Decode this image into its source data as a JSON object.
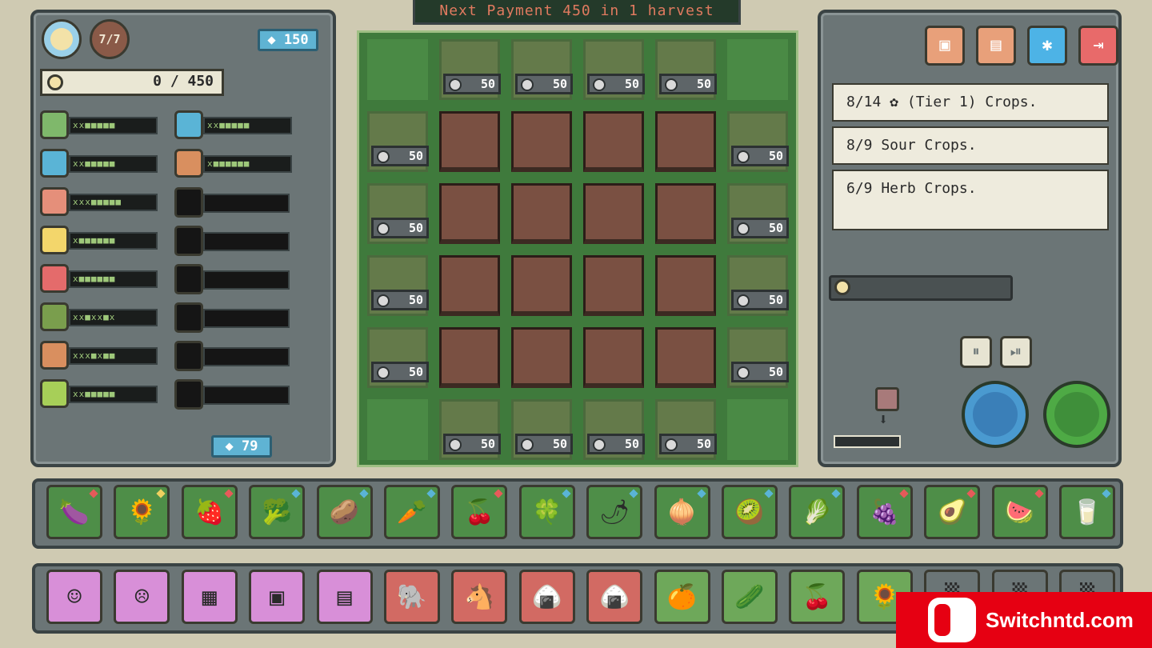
{
  "banner": {
    "text": "Next Payment 450 in 1 harvest"
  },
  "left_panel": {
    "day_counter": "7/7",
    "coins": "150",
    "money_progress": "0 / 450",
    "seed_coins": "79",
    "money_progress_fraction": 0.0
  },
  "stats": [
    {
      "icon": "leaf-icon",
      "color": "#7fb86b",
      "pips": "xx■■■■■"
    },
    {
      "icon": "snowflake-icon",
      "color": "#5ab4d6",
      "pips": "xx■■■■■"
    },
    {
      "icon": "berry-icon",
      "color": "#e58f7a",
      "pips": "xxx■■■■■"
    },
    {
      "icon": "smile-icon",
      "color": "#f3d66b",
      "pips": "x■■■■■■"
    },
    {
      "icon": "angry-face-icon",
      "color": "#e46b6b",
      "pips": "x■■■■■■"
    },
    {
      "icon": "seeds-icon",
      "color": "#7a9e4d",
      "pips": "xx■xx■x"
    },
    {
      "icon": "moon-icon",
      "color": "#d98f5f",
      "pips": "xxx■x■■"
    },
    {
      "icon": "flower-icon",
      "color": "#a7cf58",
      "pips": "xx■■■■■"
    },
    {
      "icon": "water-drop-icon",
      "color": "#5ab4d6",
      "pips": "xx■■■■■"
    },
    {
      "icon": "brush-icon",
      "color": "#d98f5f",
      "pips": "x■■■■■■"
    }
  ],
  "farm": {
    "plot_price": "50"
  },
  "menu": {
    "buttons": [
      {
        "icon": "save-icon",
        "color": "#e8a07a",
        "glyph": "▣"
      },
      {
        "icon": "notes-icon",
        "color": "#e8a07a",
        "glyph": "▤"
      },
      {
        "icon": "settings-icon",
        "color": "#4db3e6",
        "glyph": "✱"
      },
      {
        "icon": "exit-icon",
        "color": "#e86a6a",
        "glyph": "⇥"
      }
    ]
  },
  "quests": [
    {
      "text": "8/14 ✿ (Tier 1) Crops."
    },
    {
      "text": "8/9 Sour Crops."
    },
    {
      "text": "6/9 Herb Crops."
    }
  ],
  "controls": {
    "pause_glyph": "⏸",
    "play_glyph": "⏯"
  },
  "crop_cards": [
    {
      "icon": "eggplant-icon",
      "glyph": "🍆",
      "dot": "#e65a5a"
    },
    {
      "icon": "sunflower-icon",
      "glyph": "🌻",
      "dot": "#f0d060"
    },
    {
      "icon": "strawberry-icon",
      "glyph": "🍓",
      "dot": "#e65a5a"
    },
    {
      "icon": "broccoli-icon",
      "glyph": "🥦",
      "dot": "#5ab4d6"
    },
    {
      "icon": "potato-icon",
      "glyph": "🥔",
      "dot": "#5ab4d6"
    },
    {
      "icon": "carrot-icon",
      "glyph": "🥕",
      "dot": "#5ab4d6"
    },
    {
      "icon": "cherries-icon",
      "glyph": "🍒",
      "dot": "#e65a5a"
    },
    {
      "icon": "clover-icon",
      "glyph": "🍀",
      "dot": "#5ab4d6"
    },
    {
      "icon": "chili-icon",
      "glyph": "🌶",
      "dot": "#5ab4d6"
    },
    {
      "icon": "turnip-icon",
      "glyph": "🧅",
      "dot": "#5ab4d6"
    },
    {
      "icon": "kiwi-icon",
      "glyph": "🥝",
      "dot": "#5ab4d6"
    },
    {
      "icon": "celery-icon",
      "glyph": "🥬",
      "dot": "#5ab4d6"
    },
    {
      "icon": "grapes-icon",
      "glyph": "🍇",
      "dot": "#e65a5a"
    },
    {
      "icon": "avocado-icon",
      "glyph": "🥑",
      "dot": "#e65a5a"
    },
    {
      "icon": "watermelon-icon",
      "glyph": "🍉",
      "dot": "#e65a5a"
    },
    {
      "icon": "milk-icon",
      "glyph": "🥛",
      "dot": "#5ab4d6"
    }
  ],
  "item_cards": [
    {
      "icon": "happy-note-icon",
      "glyph": "☺",
      "bg": "#d88fd8"
    },
    {
      "icon": "sad-note-icon",
      "glyph": "☹",
      "bg": "#d88fd8"
    },
    {
      "icon": "grid-note-icon",
      "glyph": "▦",
      "bg": "#d88fd8"
    },
    {
      "icon": "berry-note-icon",
      "glyph": "▣",
      "bg": "#d88fd8"
    },
    {
      "icon": "color-note-icon",
      "glyph": "▤",
      "bg": "#d88fd8"
    },
    {
      "icon": "elephant-icon",
      "glyph": "🐘",
      "bg": "#d26a63"
    },
    {
      "icon": "horse-icon",
      "glyph": "🐴",
      "bg": "#d26a63"
    },
    {
      "icon": "onigiri-icon",
      "glyph": "🍙",
      "bg": "#d26a63"
    },
    {
      "icon": "onigiri-alt-icon",
      "glyph": "🍙",
      "bg": "#d26a63"
    },
    {
      "icon": "orange-icon",
      "glyph": "🍊",
      "bg": "#6ea85a"
    },
    {
      "icon": "pickle-icon",
      "glyph": "🥒",
      "bg": "#6ea85a"
    },
    {
      "icon": "cherries-icon",
      "glyph": "🍒",
      "bg": "#6ea85a"
    },
    {
      "icon": "sunflower-icon",
      "glyph": "🌻",
      "bg": "#6ea85a"
    },
    {
      "icon": "locked-slot-icon",
      "glyph": "▒",
      "bg": "#6b7576"
    },
    {
      "icon": "locked-slot-icon",
      "glyph": "▒",
      "bg": "#6b7576"
    },
    {
      "icon": "locked-slot-icon",
      "glyph": "▒",
      "bg": "#6b7576"
    }
  ],
  "watermark": {
    "text": "Switchntd.com"
  }
}
